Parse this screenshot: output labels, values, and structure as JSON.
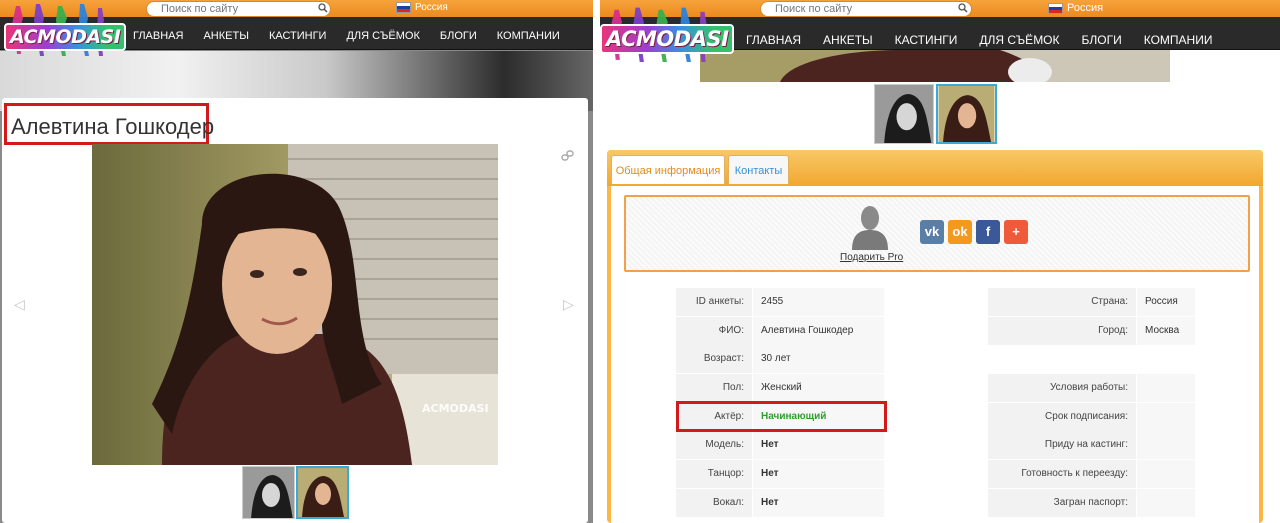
{
  "header": {
    "search_placeholder": "Поиск по сайту",
    "country": "Россия",
    "logo": "ACMODASI",
    "nav": [
      "Главная",
      "Анкеты",
      "Кастинги",
      "Для съёмок",
      "Блоги",
      "Компании"
    ]
  },
  "profile": {
    "name": "Алевтина Гошкодер",
    "watermark": "ACMODASI"
  },
  "tabs": [
    "Общая информация",
    "Контакты"
  ],
  "share": {
    "pro_label": "Подарить Pro",
    "socials": [
      {
        "name": "vk",
        "glyph": "vk",
        "color": "#5a7fa6"
      },
      {
        "name": "odnoklassniki",
        "glyph": "ok",
        "color": "#f39a1e"
      },
      {
        "name": "facebook",
        "glyph": "f",
        "color": "#3b5998"
      },
      {
        "name": "more",
        "glyph": "+",
        "color": "#ef5a3b"
      }
    ]
  },
  "info_left": [
    {
      "label": "ID анкеты:",
      "value": "2455"
    },
    {
      "label": "ФИО:",
      "value": "Алевтина Гошкодер"
    },
    {
      "label": "Возраст:",
      "value": "30 лет"
    },
    {
      "label": "Пол:",
      "value": "Женский"
    },
    {
      "label": "Актёр:",
      "value": "Начинающий"
    },
    {
      "label": "Модель:",
      "value": "Нет"
    },
    {
      "label": "Танцор:",
      "value": "Нет"
    },
    {
      "label": "Вокал:",
      "value": "Нет"
    }
  ],
  "info_right": [
    {
      "label": "Страна:",
      "value": "Россия"
    },
    {
      "label": "Город:",
      "value": "Москва"
    },
    {
      "label": "Условия работы:",
      "value": ""
    },
    {
      "label": "Срок подписания:",
      "value": ""
    },
    {
      "label": "Приду на кастинг:",
      "value": ""
    },
    {
      "label": "Готовность к переезду:",
      "value": ""
    },
    {
      "label": "Загран паспорт:",
      "value": ""
    }
  ],
  "colors": {
    "accent": "#f2a72f",
    "highlight": "#d21a1a",
    "active_tab": "#e28d16",
    "link": "#3a8fd1",
    "green": "#2f9e2f"
  }
}
